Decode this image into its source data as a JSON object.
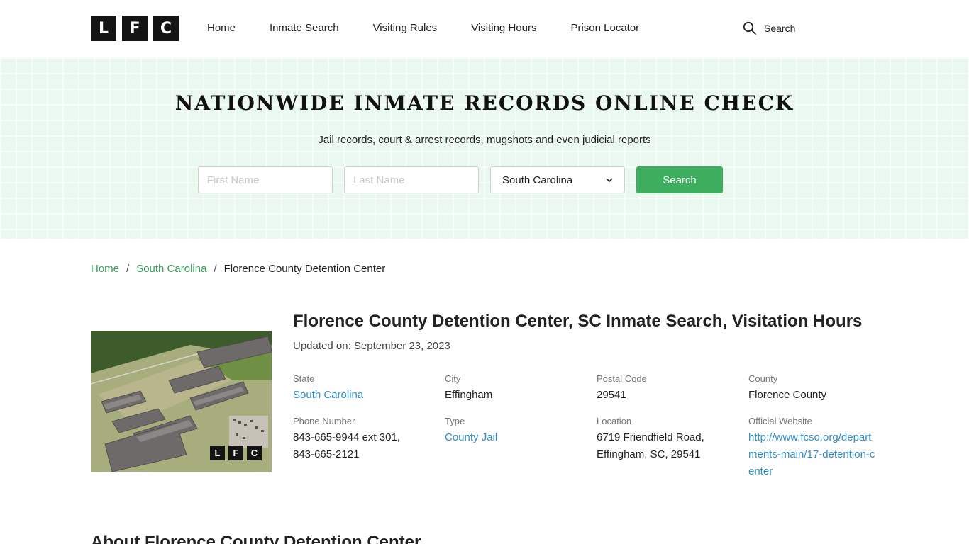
{
  "header": {
    "logo_letters": [
      "L",
      "F",
      "C"
    ],
    "nav": [
      "Home",
      "Inmate Search",
      "Visiting Rules",
      "Visiting Hours",
      "Prison Locator"
    ],
    "search_label": "Search"
  },
  "hero": {
    "title": "NATIONWIDE INMATE RECORDS ONLINE CHECK",
    "subtitle": "Jail records, court & arrest records, mugshots and even judicial reports",
    "first_name_placeholder": "First Name",
    "last_name_placeholder": "Last Name",
    "state_selected": "South Carolina",
    "search_button": "Search"
  },
  "breadcrumb": {
    "home": "Home",
    "state": "South Carolina",
    "current": "Florence County Detention Center",
    "separator": "/"
  },
  "facility": {
    "title": "Florence County Detention Center, SC Inmate Search, Visitation Hours",
    "updated": "Updated on: September 23, 2023",
    "photo_badge": [
      "L",
      "F",
      "C"
    ],
    "fields": {
      "state": {
        "label": "State",
        "value": "South Carolina"
      },
      "city": {
        "label": "City",
        "value": "Effingham"
      },
      "postal": {
        "label": "Postal Code",
        "value": "29541"
      },
      "county": {
        "label": "County",
        "value": "Florence County"
      },
      "phone": {
        "label": "Phone Number",
        "value": "843-665-9944 ext 301, 843-665-2121"
      },
      "type": {
        "label": "Type",
        "value": "County Jail"
      },
      "location": {
        "label": "Location",
        "value": "6719 Friendfield Road, Effingham, SC, 29541"
      },
      "website": {
        "label": "Official Website",
        "value": "http://www.fcso.org/departments-main/17-detention-center"
      }
    }
  },
  "about_heading": "About Florence County Detention Center",
  "colors": {
    "accent_green": "#3dae5e",
    "link_green": "#3a9d5a",
    "link_blue": "#2f8fc7",
    "hero_bg": "#eaf8ef"
  }
}
